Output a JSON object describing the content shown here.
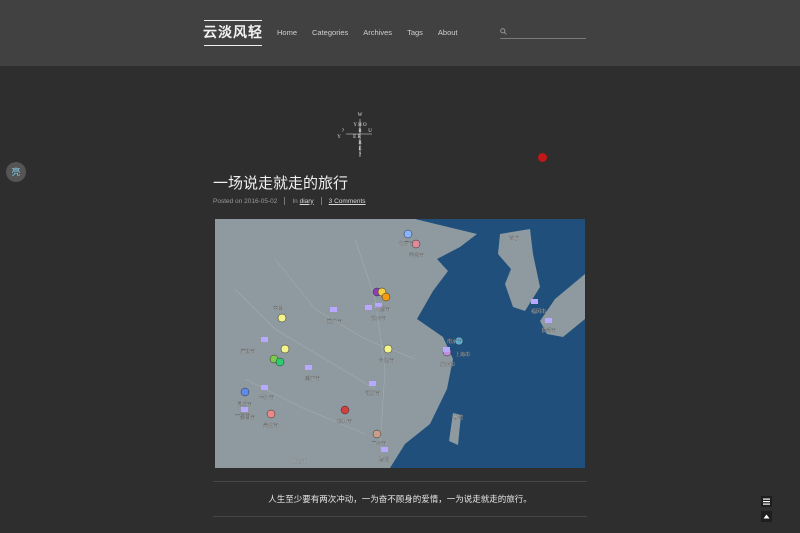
{
  "header": {
    "logo": "云淡风轻",
    "nav": [
      "Home",
      "Categories",
      "Archives",
      "Tags",
      "About"
    ],
    "search_placeholder": ""
  },
  "side_toggle": "亮",
  "post": {
    "title": "一场说走就走的旅行",
    "posted_on_label": "Posted on",
    "date": "2016-05-02",
    "in_label": "In",
    "category": "diary",
    "comments": "3 Comments",
    "quote": "人生至少要有两次冲动，一为奋不顾身的爱情，一为说走就走的旅行。"
  },
  "map": {
    "labels": [
      "北京市",
      "天津市",
      "济南市",
      "郑州市",
      "西安市",
      "中国",
      "成都市",
      "重庆市",
      "合肥市",
      "南京市",
      "上海市",
      "杭州市",
      "武汉市",
      "长沙市",
      "南昌市",
      "桂林市",
      "昆明市",
      "大理市",
      "贵阳市",
      "广州市",
      "香港",
      "台湾",
      "首尔",
      "福冈市",
      "长崎市",
      "Hanoi"
    ]
  },
  "colors": {
    "background": "#2e2e2e",
    "header": "#414141",
    "side_toggle_text": "#7fc8e8",
    "red_dot": "#c01818",
    "sea": "#1f4f7a",
    "land": "#8e9aa0"
  }
}
